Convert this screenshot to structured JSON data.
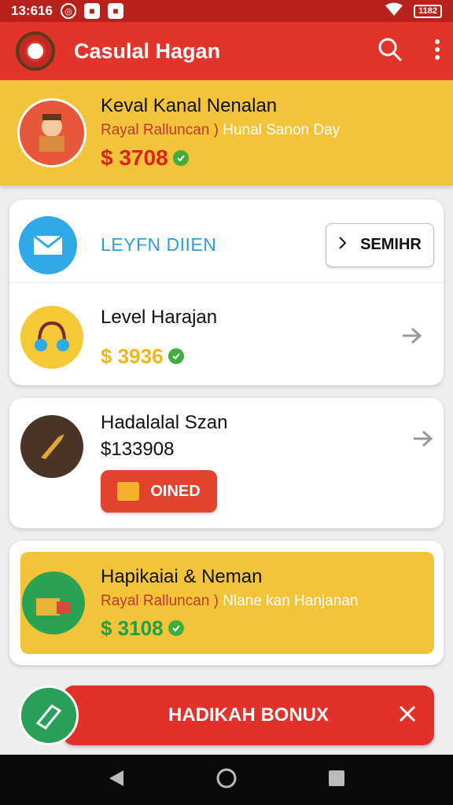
{
  "status_bar": {
    "time": "13:616",
    "battery": "1182"
  },
  "app_bar": {
    "title": "Casulal Hagan",
    "icons": [
      "app-logo",
      "search-icon",
      "more-vert-icon"
    ]
  },
  "hero": {
    "title": "Keval Kanal Nenalan",
    "sub_a": "Rayal Ralluncan )",
    "sub_b": "Hunal Sanon Day",
    "price": "$ 3708",
    "price_color": "#d8241c"
  },
  "card_level": {
    "label": "LEYFN DIIEN",
    "search_label": "SEMIHR",
    "item_title": "Level Harajan",
    "item_price": "$ 3936",
    "price_color": "#f2b51d"
  },
  "card_owned": {
    "title": "Hadalalal Szan",
    "price": "$133908",
    "button_label": "OINED"
  },
  "card_highlight": {
    "title": "Hapikaiai & Neman",
    "sub_a": "Rayal Ralluncan )",
    "sub_b": "Nlane kan Hanjanan",
    "price": "$ 3108",
    "price_color": "#22a045"
  },
  "bonus": {
    "label": "HADIKAH BONUX"
  },
  "nav": {
    "icons": [
      "back-icon",
      "home-icon",
      "recents-icon"
    ]
  }
}
